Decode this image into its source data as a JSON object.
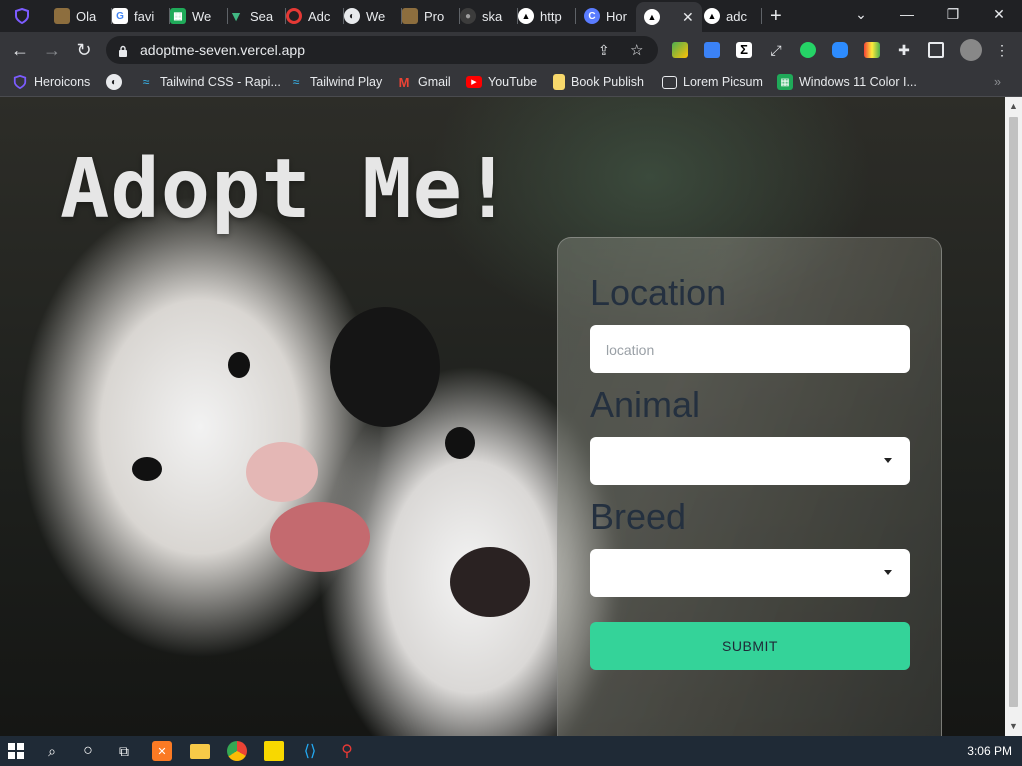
{
  "browser": {
    "tabs": [
      {
        "title": "Ola",
        "icon": "folder-icon",
        "color": "#8d6e3e"
      },
      {
        "title": "favi",
        "icon": "google-icon",
        "color": "#ffffff"
      },
      {
        "title": "We",
        "icon": "green-grid-icon",
        "color": "#1faa59"
      },
      {
        "title": "Sea",
        "icon": "vue-icon",
        "color": "#41b883"
      },
      {
        "title": "Adc",
        "icon": "target-icon",
        "color": "#e53935"
      },
      {
        "title": "We",
        "icon": "globe-icon",
        "color": "#ffffff"
      },
      {
        "title": "Pro",
        "icon": "folder-icon",
        "color": "#8d6e3e"
      },
      {
        "title": "ska",
        "icon": "github-icon",
        "color": "#9e9e9e"
      },
      {
        "title": "http",
        "icon": "triangle-icon",
        "color": "#ffffff"
      },
      {
        "title": "Hor",
        "icon": "c-icon",
        "color": "#5a7cff"
      },
      {
        "title": "",
        "icon": "triangle-icon",
        "color": "#ffffff"
      },
      {
        "title": "adc",
        "icon": "triangle-icon",
        "color": "#ffffff"
      }
    ],
    "url": "adoptme-seven.vercel.app",
    "bookmarks": [
      {
        "label": "Heroicons",
        "icon": "shield-icon"
      },
      {
        "label": "",
        "icon": "globe-icon"
      },
      {
        "label": "Tailwind CSS - Rapi...",
        "icon": "tailwind-icon"
      },
      {
        "label": "Tailwind Play",
        "icon": "tailwind-icon"
      },
      {
        "label": "Gmail",
        "icon": "gmail-icon"
      },
      {
        "label": "YouTube",
        "icon": "youtube-icon"
      },
      {
        "label": "Book Publish",
        "icon": "folder-icon"
      },
      {
        "label": "Lorem Picsum",
        "icon": "image-icon"
      },
      {
        "label": "Windows 11 Color I...",
        "icon": "green-grid-icon"
      }
    ],
    "overflow": "»"
  },
  "page": {
    "title": "Adopt Me!",
    "form": {
      "location_label": "Location",
      "location_placeholder": "location",
      "location_value": "",
      "animal_label": "Animal",
      "animal_value": "",
      "breed_label": "Breed",
      "breed_value": "",
      "submit_label": "SUBMIT"
    }
  },
  "taskbar": {
    "time": "3:06 PM"
  },
  "colors": {
    "accent": "#34d399",
    "label": "#24303f"
  }
}
